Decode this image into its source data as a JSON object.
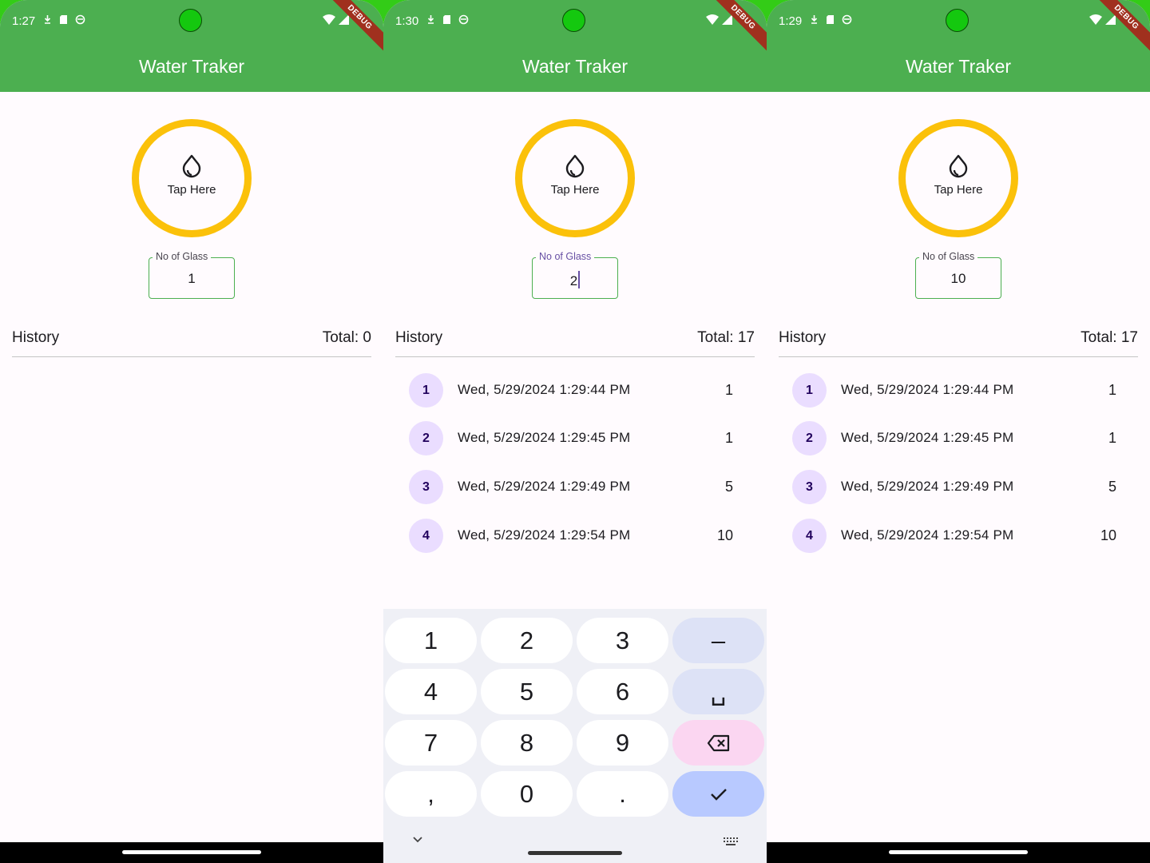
{
  "screens": [
    {
      "status_time": "1:27",
      "debug_banner": "DEBUG",
      "app_title": "Water Traker",
      "tap_label": "Tap Here",
      "glass_field": {
        "label": "No of Glass",
        "value": "1"
      },
      "history_label": "History",
      "total_label": "Total: 0",
      "history": []
    },
    {
      "status_time": "1:30",
      "debug_banner": "DEBUG",
      "app_title": "Water Traker",
      "tap_label": "Tap Here",
      "glass_field": {
        "label": "No of Glass",
        "value": "2"
      },
      "history_label": "History",
      "total_label": "Total: 17",
      "history": [
        {
          "index": "1",
          "date": "Wed, 5/29/2024 1:29:44 PM",
          "count": "1"
        },
        {
          "index": "2",
          "date": "Wed, 5/29/2024 1:29:45 PM",
          "count": "1"
        },
        {
          "index": "3",
          "date": "Wed, 5/29/2024 1:29:49 PM",
          "count": "5"
        },
        {
          "index": "4",
          "date": "Wed, 5/29/2024 1:29:54 PM",
          "count": "10"
        }
      ],
      "keyboard": {
        "keys": [
          "1",
          "2",
          "3",
          "–",
          "4",
          "5",
          "6",
          "␣",
          "7",
          "8",
          "9",
          "⌫",
          ",",
          "0",
          ".",
          "✓"
        ]
      }
    },
    {
      "status_time": "1:29",
      "debug_banner": "DEBUG",
      "app_title": "Water Traker",
      "tap_label": "Tap Here",
      "glass_field": {
        "label": "No of Glass",
        "value": "10"
      },
      "history_label": "History",
      "total_label": "Total: 17",
      "history": [
        {
          "index": "1",
          "date": "Wed, 5/29/2024 1:29:44 PM",
          "count": "1"
        },
        {
          "index": "2",
          "date": "Wed, 5/29/2024 1:29:45 PM",
          "count": "1"
        },
        {
          "index": "3",
          "date": "Wed, 5/29/2024 1:29:49 PM",
          "count": "5"
        },
        {
          "index": "4",
          "date": "Wed, 5/29/2024 1:29:54 PM",
          "count": "10"
        }
      ]
    }
  ],
  "colors": {
    "app_bar": "#4caf50",
    "ring": "#fbc10a",
    "badge_bg": "#eaddff",
    "badge_text": "#21005d"
  },
  "icons": {
    "tap_button": "water-drop-icon",
    "status_bar": [
      "download-icon",
      "sd-card-icon",
      "sync-icon",
      "wifi-icon",
      "signal-icon"
    ],
    "keyboard": [
      "backspace-icon",
      "check-icon",
      "chevron-down-icon",
      "keyboard-icon"
    ]
  }
}
